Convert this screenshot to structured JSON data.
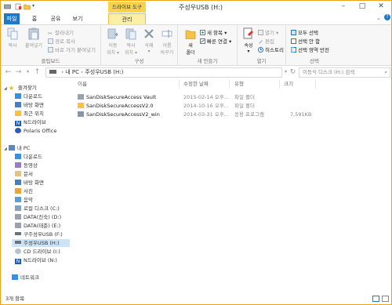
{
  "window": {
    "title": "주성우USB (H:)",
    "context_tab_title": "드라이브 도구",
    "controls": {
      "minimize": "–",
      "maximize": "□",
      "close": "✕"
    }
  },
  "ribbon_tabs": [
    "파일",
    "홈",
    "공유",
    "보기",
    "관리"
  ],
  "ribbon": {
    "clipboard": {
      "label": "클립보드",
      "copy": "복사",
      "paste": "붙여넣기",
      "cut": "잘라내기",
      "copy_path": "경로 복사",
      "paste_shortcut": "바로 가기 붙여넣기"
    },
    "organize": {
      "label": "구성",
      "move_to": "이동\n위치 ▾",
      "copy_to": "복사\n위치 ▾",
      "delete": "삭제\n▾",
      "rename": "이름\n바꾸기"
    },
    "new": {
      "label": "새 만들기",
      "new_folder": "새\n폴더",
      "new_item": "새 항목 ▾",
      "easy_access": "빠른 연결 ▾"
    },
    "open": {
      "label": "열기",
      "properties": "속성\n▾",
      "open": "열기 ▾",
      "edit": "편집",
      "history": "히스토리"
    },
    "select": {
      "label": "선택",
      "select_all": "모두 선택",
      "select_none": "선택 안 함",
      "invert": "선택 영역 반전"
    }
  },
  "address_bar": {
    "path": [
      "내 PC",
      "주성우USB (H:)"
    ],
    "search_placeholder": "이동식 디스크 (H:) 검색"
  },
  "nav_pane": {
    "favorites_header": "즐겨찾기",
    "favorites": [
      "다운로드",
      "바탕 화면",
      "최근 위치",
      "N드라이브",
      "Polaris Office"
    ],
    "pc_header": "내 PC",
    "pc_items": [
      "다운로드",
      "동영상",
      "문서",
      "바탕 화면",
      "사진",
      "음악",
      "로컬 디스크 (C:)",
      "DATA(진숙) (D:)",
      "DATA(태준) (E:)",
      "구주성우USB (F:)",
      "주성우USB (H:)",
      "CD 드라이브 (I:)",
      "N드라이브 (N:)"
    ],
    "network": "네트워크"
  },
  "file_list": {
    "columns": {
      "name": "이름",
      "modified": "수정한 날짜",
      "type": "유형",
      "size": "크기"
    },
    "rows": [
      {
        "name": "SanDiskSecureAccess Vault",
        "modified": "2015-02-14 오후...",
        "type": "파일 폴더",
        "size": "",
        "icon": "folder-icon"
      },
      {
        "name": "SanDiskSecureAccessV2.0",
        "modified": "2014-10-16 오후...",
        "type": "파일 폴더",
        "size": "",
        "icon": "folder-icon"
      },
      {
        "name": "SanDiskSecureAccessV2_win",
        "modified": "2014-03-31 오후...",
        "type": "응용 프로그램",
        "size": "7,591KB",
        "icon": "application-icon"
      }
    ]
  },
  "status_bar": {
    "item_count": "3개 항목"
  },
  "colors": {
    "accent": "#1e78c8",
    "frame": "#f0a218",
    "context_tab": "#f5d34a",
    "selection": "#cce4f7"
  }
}
